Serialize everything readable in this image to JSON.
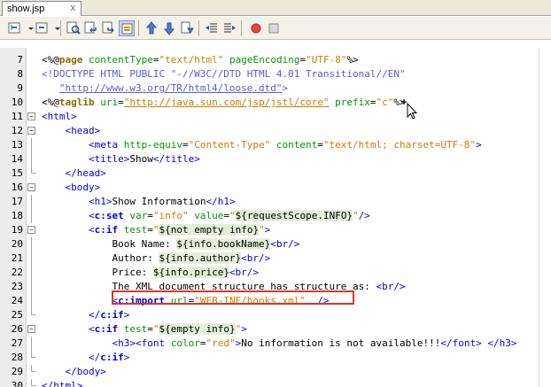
{
  "tab": {
    "label": "show.jsp",
    "close": "x"
  },
  "toolbar": {
    "icons": [
      "back-icon",
      "history-dropdown-icon",
      "forward-icon",
      "forward-dropdown-icon",
      "find-icon",
      "find-previous-icon",
      "find-next-icon",
      "toggle-highlight-icon",
      "previous-bookmark-icon",
      "next-bookmark-icon",
      "toggle-bookmark-icon",
      "shift-left-icon",
      "shift-right-icon",
      "start-macro-icon",
      "stop-macro-icon"
    ]
  },
  "colors": {
    "tag": "#0000e6",
    "attribute": "#009900",
    "string": "#ce7b00",
    "directive": "#8a6a00",
    "highlight_border": "#e0342a"
  },
  "lines": [
    {
      "n": "7",
      "fold": "",
      "segs": [
        [
          "dl",
          "<%@"
        ],
        [
          "d bd",
          "page"
        ],
        [
          "dl",
          " "
        ],
        [
          "a",
          "contentType"
        ],
        [
          "dl",
          "="
        ],
        [
          "s",
          "\"text/html\""
        ],
        [
          "dl",
          " "
        ],
        [
          "a",
          "pageEncoding"
        ],
        [
          "dl",
          "="
        ],
        [
          "s",
          "\"UTF-8\""
        ],
        [
          "dl",
          "%>"
        ]
      ]
    },
    {
      "n": "8",
      "fold": "",
      "segs": [
        [
          "dt",
          "<!DOCTYPE HTML PUBLIC \"-//W3C//DTD HTML 4.01 Transitional//EN\""
        ]
      ]
    },
    {
      "n": "9",
      "fold": "",
      "segs": [
        [
          "dt",
          "   "
        ],
        [
          "dt u",
          "\"http://www.w3.org/TR/html4/loose.dtd\""
        ],
        [
          "dt",
          ">"
        ]
      ]
    },
    {
      "n": "10",
      "fold": "",
      "segs": [
        [
          "dl",
          "<%@"
        ],
        [
          "d bd",
          "taglib"
        ],
        [
          "dl",
          " "
        ],
        [
          "a",
          "uri"
        ],
        [
          "dl",
          "="
        ],
        [
          "s u",
          "\"http://java.sun.com/jsp/jstl/core\""
        ],
        [
          "dl",
          " "
        ],
        [
          "a",
          "prefix"
        ],
        [
          "dl",
          "="
        ],
        [
          "s",
          "\"c\""
        ],
        [
          "dl",
          "%>"
        ]
      ]
    },
    {
      "n": "11",
      "fold": "open",
      "segs": [
        [
          "t",
          "<html>"
        ]
      ]
    },
    {
      "n": "12",
      "fold": "open",
      "segs": [
        [
          "t",
          "    <head>"
        ]
      ]
    },
    {
      "n": "13",
      "fold": "line",
      "segs": [
        [
          "t",
          "        <meta "
        ],
        [
          "a",
          "http-equiv"
        ],
        [
          "dl",
          "="
        ],
        [
          "s",
          "\"Content-Type\""
        ],
        [
          "dl",
          " "
        ],
        [
          "a",
          "content"
        ],
        [
          "dl",
          "="
        ],
        [
          "s",
          "\"text/html; charset=UTF-8\""
        ],
        [
          "t",
          ">"
        ]
      ]
    },
    {
      "n": "14",
      "fold": "line",
      "segs": [
        [
          "t",
          "        <title>"
        ],
        [
          "dl",
          "Show"
        ],
        [
          "t",
          "</title>"
        ]
      ]
    },
    {
      "n": "15",
      "fold": "end",
      "segs": [
        [
          "t",
          "    </head>"
        ]
      ]
    },
    {
      "n": "16",
      "fold": "open",
      "segs": [
        [
          "t",
          "    <body>"
        ]
      ]
    },
    {
      "n": "17",
      "fold": "line",
      "segs": [
        [
          "t",
          "        <h1>"
        ],
        [
          "dl",
          "Show Information"
        ],
        [
          "t",
          "</h1>"
        ]
      ]
    },
    {
      "n": "18",
      "fold": "line",
      "segs": [
        [
          "t",
          "        <"
        ],
        [
          "t bd",
          "c:set"
        ],
        [
          "dl",
          " "
        ],
        [
          "a",
          "var"
        ],
        [
          "dl",
          "="
        ],
        [
          "s",
          "\"info\""
        ],
        [
          "dl",
          " "
        ],
        [
          "a",
          "value"
        ],
        [
          "dl",
          "="
        ],
        [
          "s",
          "\""
        ],
        [
          "el",
          "${requestScope.INFO}"
        ],
        [
          "s",
          "\""
        ],
        [
          "t",
          "/>"
        ]
      ]
    },
    {
      "n": "19",
      "fold": "open",
      "segs": [
        [
          "t",
          "        <"
        ],
        [
          "t bd",
          "c:if"
        ],
        [
          "dl",
          " "
        ],
        [
          "a",
          "test"
        ],
        [
          "dl",
          "="
        ],
        [
          "s",
          "\""
        ],
        [
          "el",
          "${not empty info}"
        ],
        [
          "s",
          "\""
        ],
        [
          "t",
          ">"
        ]
      ]
    },
    {
      "n": "20",
      "fold": "line",
      "segs": [
        [
          "dl",
          "            Book Name: "
        ],
        [
          "el",
          "${info.bookName}"
        ],
        [
          "t",
          "<br/>"
        ]
      ]
    },
    {
      "n": "21",
      "fold": "line",
      "segs": [
        [
          "dl",
          "            Author: "
        ],
        [
          "el",
          "${info.author}"
        ],
        [
          "t",
          "<br/>"
        ]
      ]
    },
    {
      "n": "22",
      "fold": "line",
      "segs": [
        [
          "dl",
          "            Price: "
        ],
        [
          "el",
          "${info.price}"
        ],
        [
          "t",
          "<br/>"
        ]
      ]
    },
    {
      "n": "23",
      "fold": "line",
      "segs": [
        [
          "dl",
          "            The XML document structure has structure as: "
        ],
        [
          "t",
          "<br/>"
        ]
      ]
    },
    {
      "n": "24",
      "fold": "line",
      "segs": [
        [
          "t",
          "            <"
        ],
        [
          "t bd",
          "c:import"
        ],
        [
          "dl",
          " "
        ],
        [
          "a",
          "url"
        ],
        [
          "dl",
          "="
        ],
        [
          "s",
          "\"WEB-INF/books.xml\""
        ],
        [
          "dl",
          "  "
        ],
        [
          "t",
          "/>"
        ]
      ]
    },
    {
      "n": "25",
      "fold": "end",
      "segs": [
        [
          "t",
          "        </"
        ],
        [
          "t bd",
          "c:if"
        ],
        [
          "t",
          ">"
        ]
      ]
    },
    {
      "n": "26",
      "fold": "open",
      "segs": [
        [
          "t",
          "        <"
        ],
        [
          "t bd",
          "c:if"
        ],
        [
          "dl",
          " "
        ],
        [
          "a",
          "test"
        ],
        [
          "dl",
          "="
        ],
        [
          "s",
          "\""
        ],
        [
          "el",
          "${empty info}"
        ],
        [
          "s",
          "\""
        ],
        [
          "t",
          ">"
        ]
      ]
    },
    {
      "n": "27",
      "fold": "line",
      "segs": [
        [
          "t",
          "            <h3><font "
        ],
        [
          "a",
          "color"
        ],
        [
          "dl",
          "="
        ],
        [
          "s",
          "\"red\""
        ],
        [
          "t",
          ">"
        ],
        [
          "dl",
          "No information is not available!!!"
        ],
        [
          "t",
          "</font> </h3>"
        ]
      ]
    },
    {
      "n": "28",
      "fold": "end",
      "segs": [
        [
          "t",
          "        </"
        ],
        [
          "t bd",
          "c:if"
        ],
        [
          "t",
          ">"
        ]
      ]
    },
    {
      "n": "29",
      "fold": "end",
      "segs": [
        [
          "t",
          "    </body>"
        ]
      ]
    },
    {
      "n": "30",
      "fold": "end",
      "segs": [
        [
          "t",
          "</html>"
        ]
      ]
    }
  ]
}
